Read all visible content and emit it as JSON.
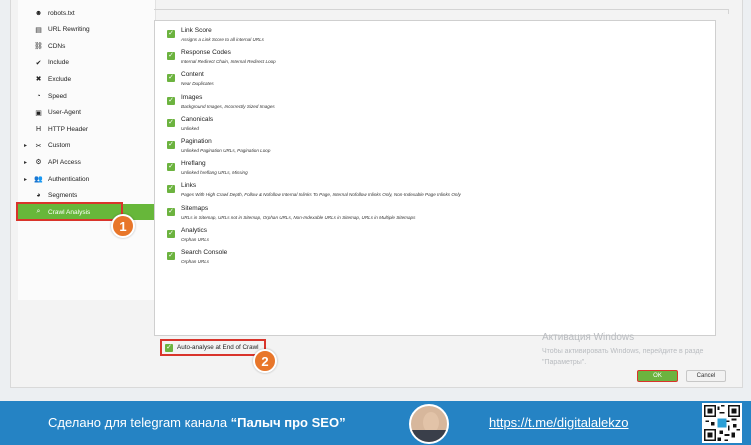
{
  "sidebar": {
    "items": [
      {
        "label": "robots.txt",
        "icon": "robot-icon",
        "arrow": ""
      },
      {
        "label": "URL Rewriting",
        "icon": "document-icon",
        "arrow": ""
      },
      {
        "label": "CDNs",
        "icon": "network-icon",
        "arrow": ""
      },
      {
        "label": "Include",
        "icon": "include-icon",
        "arrow": ""
      },
      {
        "label": "Exclude",
        "icon": "exclude-icon",
        "arrow": ""
      },
      {
        "label": "Speed",
        "icon": "speed-icon",
        "arrow": ""
      },
      {
        "label": "User-Agent",
        "icon": "user-agent-icon",
        "arrow": ""
      },
      {
        "label": "HTTP Header",
        "icon": "http-header-icon",
        "arrow": ""
      },
      {
        "label": "Custom",
        "icon": "custom-tools-icon",
        "arrow": "▸"
      },
      {
        "label": "API Access",
        "icon": "api-icon",
        "arrow": "▸"
      },
      {
        "label": "Authentication",
        "icon": "users-icon",
        "arrow": "▸"
      },
      {
        "label": "Segments",
        "icon": "segments-icon",
        "arrow": ""
      },
      {
        "label": "Crawl Analysis",
        "icon": "search-icon",
        "arrow": "",
        "selected": true
      }
    ]
  },
  "options": [
    {
      "title": "Link Score",
      "desc": "Assigns a Link Score to all internal URLs"
    },
    {
      "title": "Response Codes",
      "desc": "Internal Redirect Chain, Internal Redirect Loop"
    },
    {
      "title": "Content",
      "desc": "Near Duplicates"
    },
    {
      "title": "Images",
      "desc": "Background Images, Incorrectly Sized Images"
    },
    {
      "title": "Canonicals",
      "desc": "Unlinked"
    },
    {
      "title": "Pagination",
      "desc": "Unlinked Pagination URLs, Pagination Loop"
    },
    {
      "title": "Hreflang",
      "desc": "Unlinked hreflang URLs, Missing"
    },
    {
      "title": "Links",
      "desc": "Pages With High Crawl Depth, Follow & Nofollow Internal Inlinks To Page, Internal Nofollow Inlinks Only, Non-Indexable Page Inlinks Only"
    },
    {
      "title": "Sitemaps",
      "desc": "URLs in Sitemap, URLs not in Sitemap, Orphan URLs, Non-Indexable URLs in Sitemap, URLs in Multiple Sitemaps"
    },
    {
      "title": "Analytics",
      "desc": "Orphan URLs"
    },
    {
      "title": "Search Console",
      "desc": "Orphan URLs"
    }
  ],
  "auto_analyse": {
    "label": "Auto-analyse at End of Crawl",
    "checked": true
  },
  "badges": {
    "one": "1",
    "two": "2"
  },
  "buttons": {
    "ok": "OK",
    "cancel": "Cancel"
  },
  "watermark": {
    "line1": "Активация Windows",
    "line2": "Чтобы активировать Windows, перейдите в разде",
    "line3": "\"Параметры\"."
  },
  "banner": {
    "made_prefix": "Сделано для telegram канала ",
    "channel": "“Палыч про SEO”",
    "link": "https://t.me/digitalalekzo"
  },
  "colors": {
    "accent_green": "#6cb33f",
    "callout_red": "#d9342b",
    "badge_orange": "#e8762a",
    "banner_blue": "#2583c4"
  }
}
